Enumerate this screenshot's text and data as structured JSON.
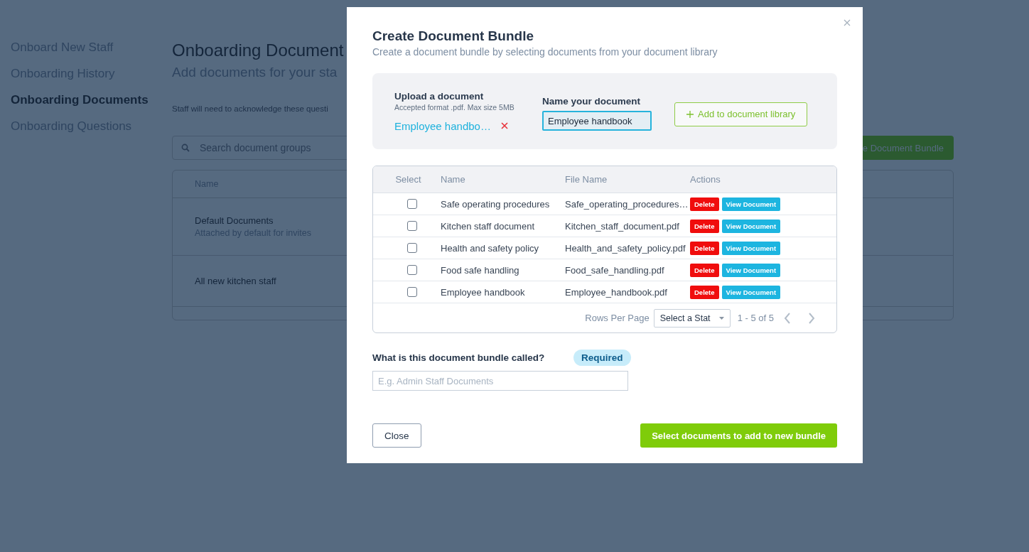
{
  "sidebar": {
    "items": [
      {
        "label": "Onboard New Staff",
        "selected": false
      },
      {
        "label": "Onboarding History",
        "selected": false
      },
      {
        "label": "Onboarding Documents",
        "selected": true
      },
      {
        "label": "Onboarding Questions",
        "selected": false
      }
    ]
  },
  "page": {
    "title": "Onboarding Document",
    "subtitle": "Add documents for your sta",
    "note": "Staff will need to acknowledge these questi",
    "search": {
      "placeholder": "Search document groups"
    },
    "create_button": "e Document Bundle",
    "table": {
      "columns": [
        "Name"
      ],
      "rows": [
        {
          "name": "Default Documents",
          "description": "Attached by default for invites"
        },
        {
          "name": "All new kitchen staff"
        }
      ]
    }
  },
  "modal": {
    "title": "Create Document Bundle",
    "subtitle": "Create a document bundle by selecting documents from your document library",
    "upload": {
      "label": "Upload a document",
      "hint": "Accepted format .pdf. Max size 5MB",
      "file": "Employee handbo…"
    },
    "name_field": {
      "label": "Name your document",
      "value": "Employee handbook"
    },
    "add_button": "Add to document library",
    "table": {
      "columns": [
        "Select",
        "Name",
        "File Name",
        "Actions"
      ],
      "rows": [
        {
          "checked": false,
          "name": "Safe operating procedures",
          "file": "Safe_operating_procedures…",
          "actions": [
            "Delete",
            "View Document"
          ]
        },
        {
          "checked": false,
          "name": "Kitchen staff document",
          "file": "Kitchen_staff_document.pdf",
          "actions": [
            "Delete",
            "View Document"
          ]
        },
        {
          "checked": false,
          "name": "Health and safety policy",
          "file": "Health_and_safety_policy.pdf",
          "actions": [
            "Delete",
            "View Document"
          ]
        },
        {
          "checked": false,
          "name": "Food safe handling",
          "file": "Food_safe_handling.pdf",
          "actions": [
            "Delete",
            "View Document"
          ]
        },
        {
          "checked": false,
          "name": "Employee handbook",
          "file": "Employee_handbook.pdf",
          "actions": [
            "Delete",
            "View Document"
          ]
        }
      ]
    },
    "pagination": {
      "label": "Rows Per Page",
      "select": "Select a Stat",
      "range": "1 - 5 of 5"
    },
    "bundle_name": {
      "label": "What is this document bundle called?",
      "badge": "Required",
      "placeholder": "E.g. Admin Staff Documents"
    },
    "buttons": {
      "close": "Close",
      "submit": "Select documents to add to new bundle"
    }
  }
}
